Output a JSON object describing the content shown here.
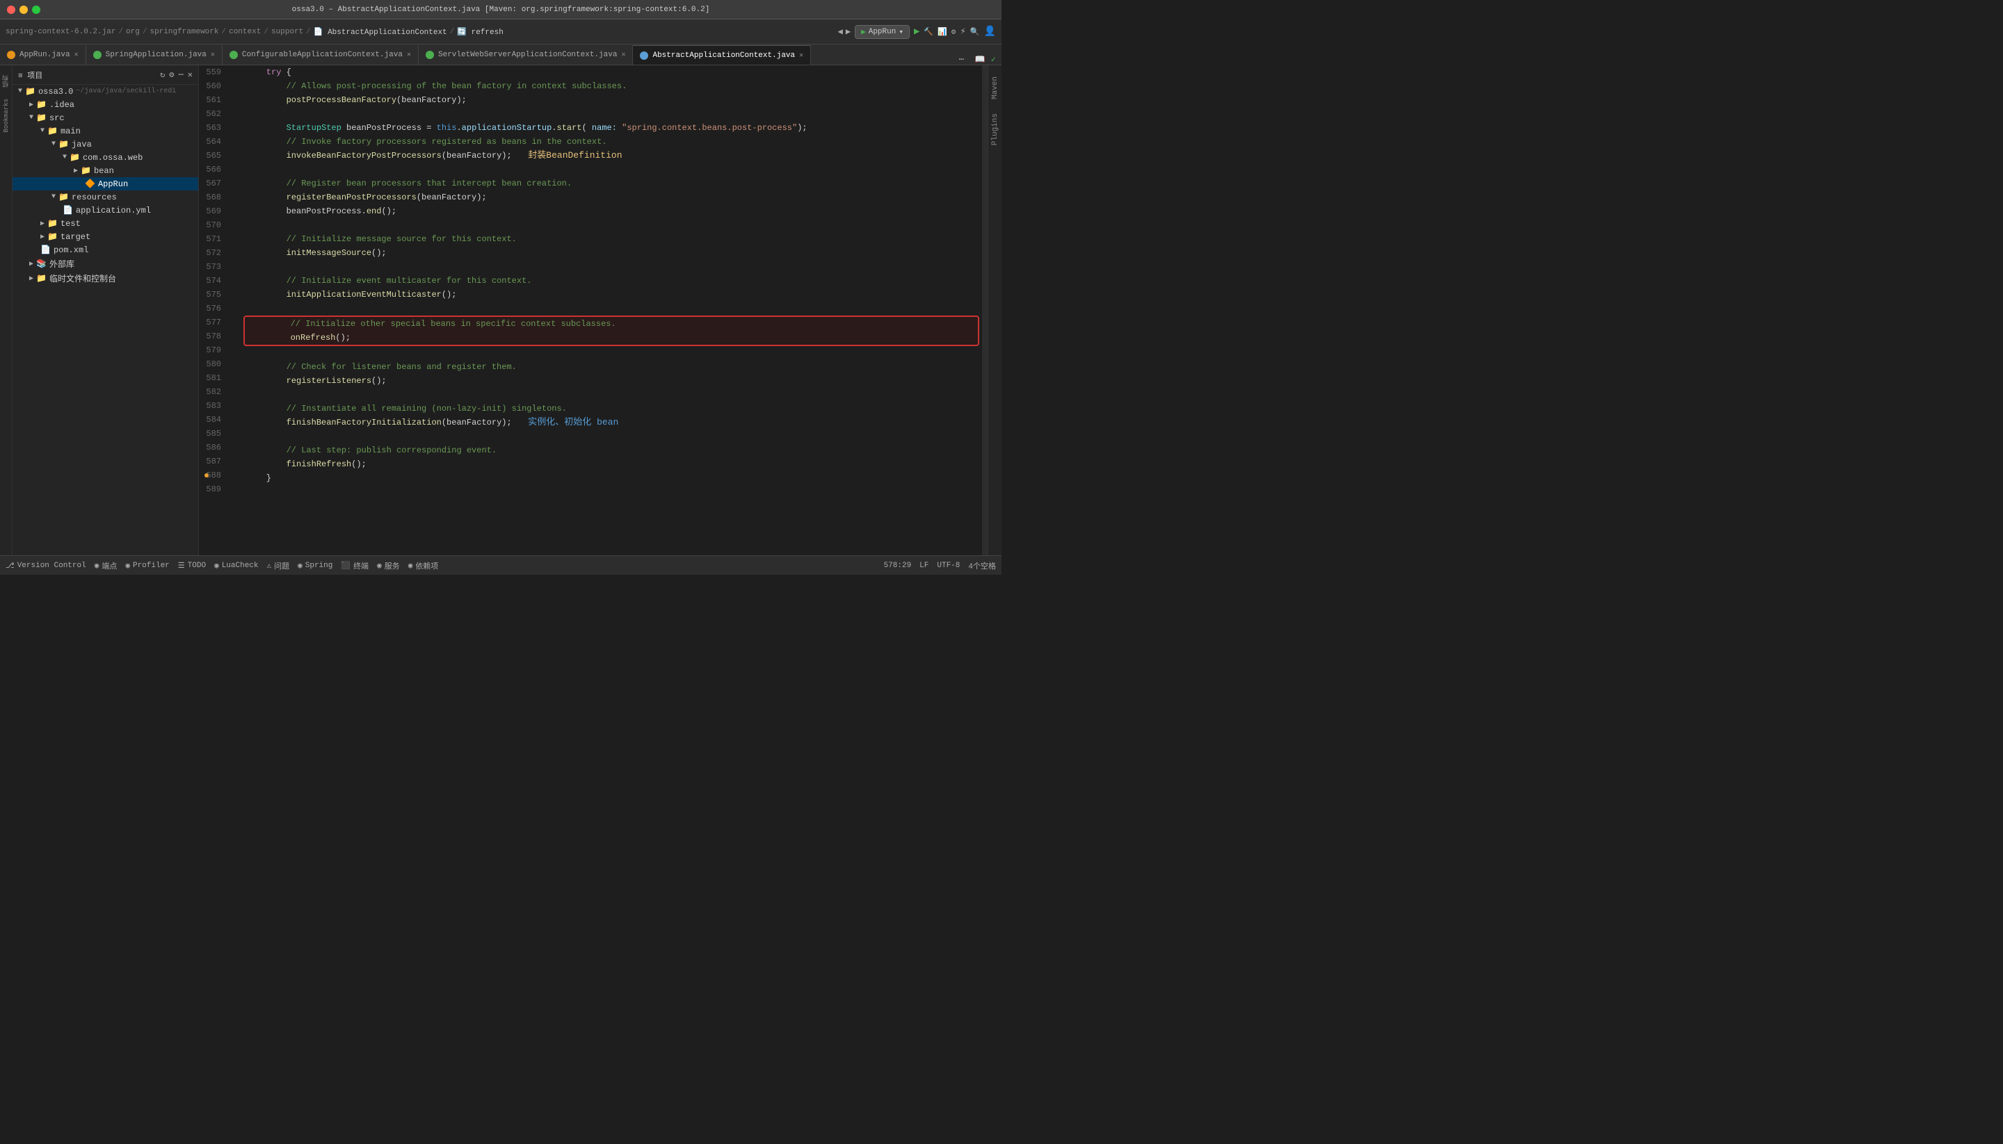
{
  "window": {
    "title": "ossa3.0 – AbstractApplicationContext.java [Maven: org.springframework:spring-context:6.0.2]",
    "controls": {
      "close": "●",
      "minimize": "●",
      "maximize": "●"
    }
  },
  "breadcrumb": {
    "items": [
      "spring-context-6.0.2.jar",
      "org",
      "springframework",
      "context",
      "support",
      "AbstractApplicationContext",
      "refresh"
    ]
  },
  "toolbar": {
    "run_label": "AppRun",
    "run_icon": "▶"
  },
  "tabs": [
    {
      "label": "AppRun.java",
      "icon": "orange",
      "active": false
    },
    {
      "label": "SpringApplication.java",
      "icon": "green",
      "active": false
    },
    {
      "label": "ConfigurableApplicationContext.java",
      "icon": "green",
      "active": false
    },
    {
      "label": "ServletWebServerApplicationContext.java",
      "icon": "green",
      "active": false
    },
    {
      "label": "AbstractApplicationContext.java",
      "icon": "blue",
      "active": true
    }
  ],
  "sidebar": {
    "title": "项目",
    "tree": [
      {
        "label": "ossa3.0",
        "indent": 0,
        "type": "project",
        "expanded": true,
        "note": "~/java/java/seckill-redi"
      },
      {
        "label": ".idea",
        "indent": 1,
        "type": "folder",
        "expanded": false
      },
      {
        "label": "src",
        "indent": 1,
        "type": "folder",
        "expanded": true
      },
      {
        "label": "main",
        "indent": 2,
        "type": "folder",
        "expanded": true
      },
      {
        "label": "java",
        "indent": 3,
        "type": "folder",
        "expanded": true
      },
      {
        "label": "com.ossa.web",
        "indent": 4,
        "type": "folder",
        "expanded": true
      },
      {
        "label": "bean",
        "indent": 5,
        "type": "folder",
        "expanded": false
      },
      {
        "label": "AppRun",
        "indent": 6,
        "type": "java",
        "selected": true
      },
      {
        "label": "resources",
        "indent": 3,
        "type": "folder",
        "expanded": true
      },
      {
        "label": "application.yml",
        "indent": 4,
        "type": "yaml"
      },
      {
        "label": "test",
        "indent": 2,
        "type": "folder",
        "expanded": false
      },
      {
        "label": "target",
        "indent": 2,
        "type": "folder",
        "expanded": false
      },
      {
        "label": "pom.xml",
        "indent": 2,
        "type": "xml"
      },
      {
        "label": "外部库",
        "indent": 1,
        "type": "folder",
        "expanded": false
      },
      {
        "label": "临时文件和控制台",
        "indent": 1,
        "type": "folder",
        "expanded": false
      }
    ]
  },
  "code": {
    "lines": [
      {
        "num": 559,
        "content": "    try {",
        "type": "normal"
      },
      {
        "num": 560,
        "content": "        // Allows post-processing of the bean factory in context subclasses.",
        "type": "comment"
      },
      {
        "num": 561,
        "content": "        postProcessBeanFactory(beanFactory);",
        "type": "normal"
      },
      {
        "num": 562,
        "content": "",
        "type": "empty"
      },
      {
        "num": 563,
        "content": "        StartupStep beanPostProcess = this.applicationStartup.start( name: \"spring.context.beans.post-process\");",
        "type": "normal",
        "has_string": true
      },
      {
        "num": 564,
        "content": "        // Invoke factory processors registered as beans in the context.",
        "type": "comment"
      },
      {
        "num": 565,
        "content": "        invokeBeanFactoryPostProcessors(beanFactory);  封装BeanDefinition",
        "type": "normal",
        "has_chinese": true,
        "chinese": "封装BeanDefinition"
      },
      {
        "num": 566,
        "content": "",
        "type": "empty"
      },
      {
        "num": 567,
        "content": "        // Register bean processors that intercept bean creation.",
        "type": "comment"
      },
      {
        "num": 568,
        "content": "        registerBeanPostProcessors(beanFactory);",
        "type": "normal"
      },
      {
        "num": 569,
        "content": "        beanPostProcess.end();",
        "type": "normal"
      },
      {
        "num": 570,
        "content": "",
        "type": "empty"
      },
      {
        "num": 571,
        "content": "        // Initialize message source for this context.",
        "type": "comment"
      },
      {
        "num": 572,
        "content": "        initMessageSource();",
        "type": "normal"
      },
      {
        "num": 573,
        "content": "",
        "type": "empty"
      },
      {
        "num": 574,
        "content": "        // Initialize event multicaster for this context.",
        "type": "comment"
      },
      {
        "num": 575,
        "content": "        initApplicationEventMulticaster();",
        "type": "normal"
      },
      {
        "num": 576,
        "content": "",
        "type": "empty"
      },
      {
        "num": 577,
        "content": "        // Initialize other special beans in specific context subclasses.",
        "type": "comment",
        "highlight": true
      },
      {
        "num": 578,
        "content": "        onRefresh();",
        "type": "normal",
        "highlight": true
      },
      {
        "num": 579,
        "content": "",
        "type": "empty"
      },
      {
        "num": 580,
        "content": "        // Check for listener beans and register them.",
        "type": "comment"
      },
      {
        "num": 581,
        "content": "        registerListeners();",
        "type": "normal"
      },
      {
        "num": 582,
        "content": "",
        "type": "empty"
      },
      {
        "num": 583,
        "content": "        // Instantiate all remaining (non-lazy-init) singletons.",
        "type": "comment"
      },
      {
        "num": 584,
        "content": "        finishBeanFactoryInitialization(beanFactory);  实例化、初始化 bean",
        "type": "normal",
        "has_chinese2": true,
        "chinese2": "实例化、初始化 bean"
      },
      {
        "num": 585,
        "content": "",
        "type": "empty"
      },
      {
        "num": 586,
        "content": "        // Last step: publish corresponding event.",
        "type": "comment"
      },
      {
        "num": 587,
        "content": "        finishRefresh();",
        "type": "normal"
      },
      {
        "num": 588,
        "content": "    }",
        "type": "normal",
        "has_marker": true
      },
      {
        "num": 589,
        "content": "",
        "type": "empty"
      }
    ]
  },
  "bottom_bar": {
    "items": [
      {
        "icon": "⎇",
        "label": "Version Control"
      },
      {
        "icon": "⬛",
        "label": "端点"
      },
      {
        "icon": "◉",
        "label": "Profiler"
      },
      {
        "icon": "☰",
        "label": "TODO"
      },
      {
        "icon": "◉",
        "label": "LuaCheck"
      },
      {
        "icon": "⚠",
        "label": "问题"
      },
      {
        "icon": "◉",
        "label": "Spring"
      },
      {
        "icon": "⬛",
        "label": "终端"
      },
      {
        "icon": "◉",
        "label": "服务"
      },
      {
        "icon": "◉",
        "label": "依赖项"
      }
    ]
  },
  "status_bar": {
    "position": "578:29",
    "encoding": "UTF-8",
    "indent": "4个空格",
    "line_ending": "LF"
  }
}
